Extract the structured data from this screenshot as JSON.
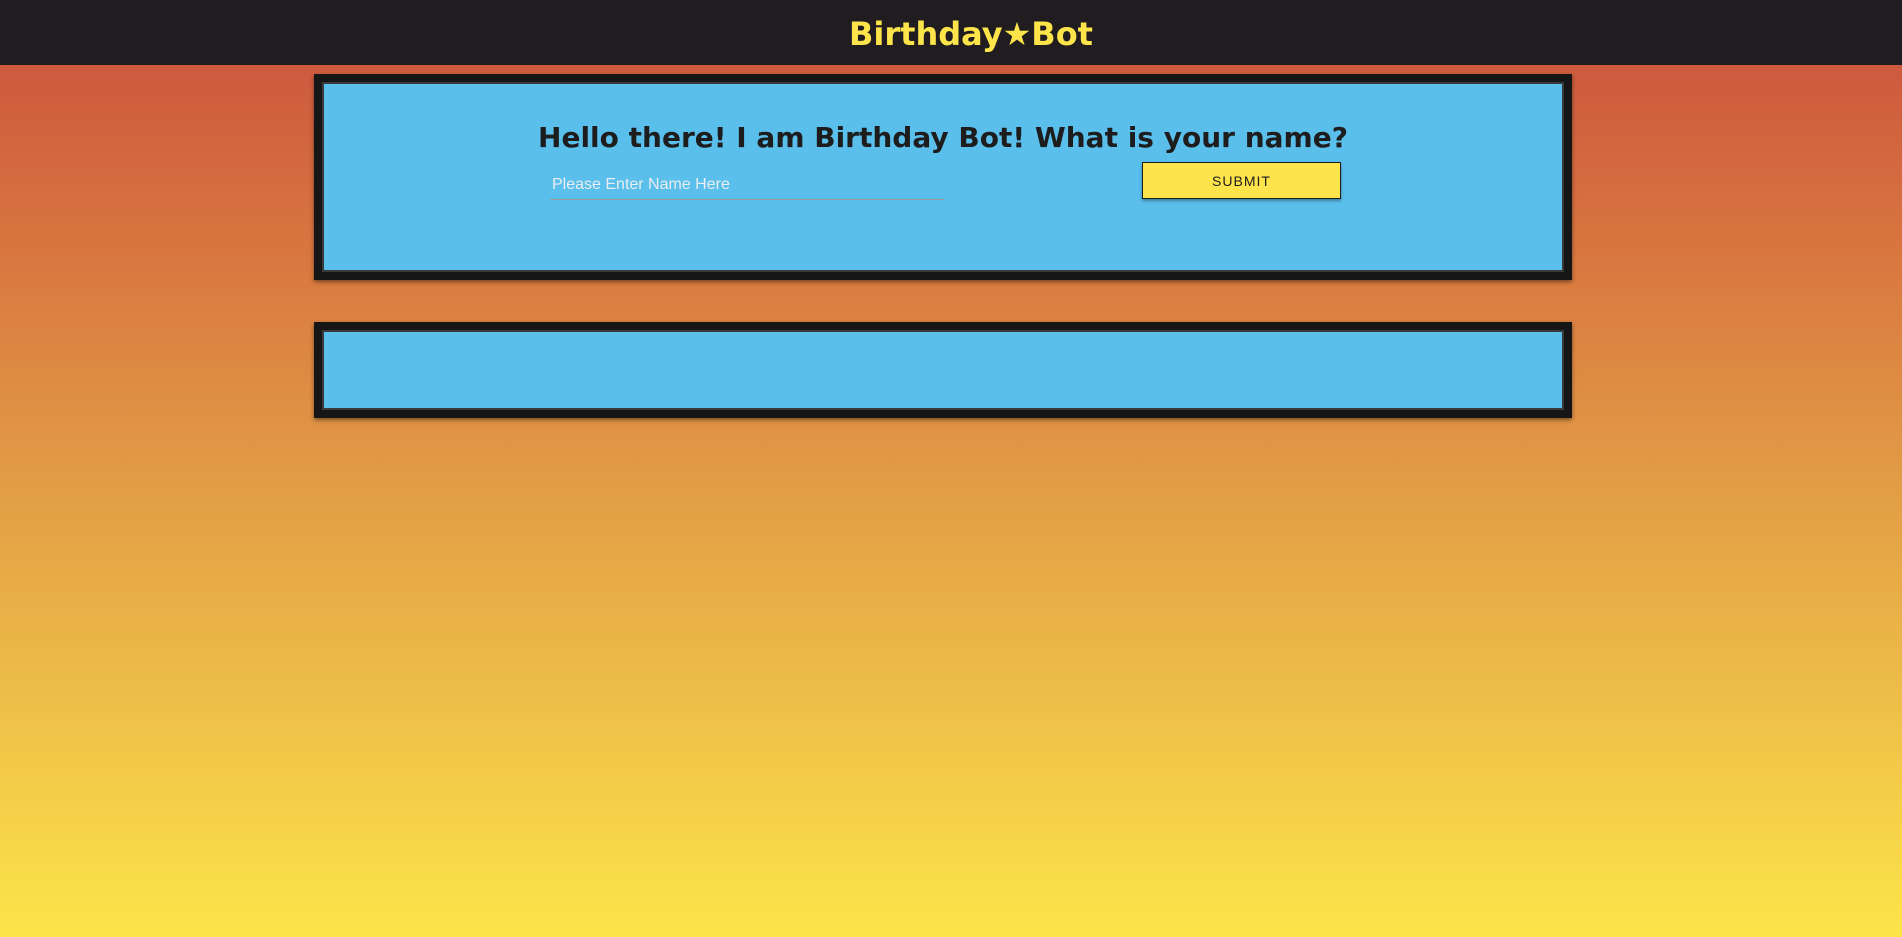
{
  "navbar": {
    "brand": "Birthday★Bot"
  },
  "greeting_card": {
    "heading": "Hello there! I am Birthday Bot! What is your name?",
    "name_input": {
      "value": "",
      "placeholder": "Please Enter Name Here"
    },
    "submit_label": "SUBMIT"
  },
  "response_card": {
    "text": ""
  },
  "colors": {
    "navbar_bg": "#201c20",
    "brand_yellow": "#fde44a",
    "card_blue": "#5bbfec",
    "card_border": "#161616",
    "gradient_top": "#c9503e",
    "gradient_bottom": "#fde449"
  }
}
